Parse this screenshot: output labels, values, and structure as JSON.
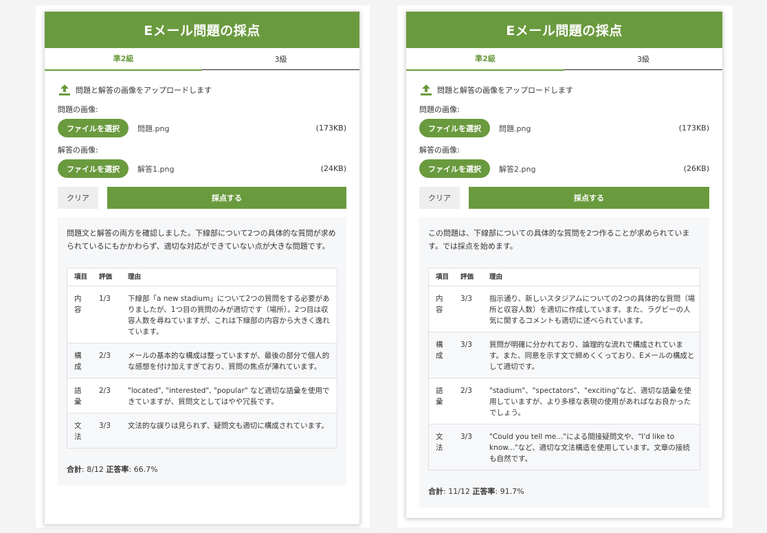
{
  "panels": [
    {
      "title": "Eメール問題の採点",
      "tabs": [
        "準2級",
        "3級"
      ],
      "upload_hint": "問題と解答の画像をアップロードします",
      "question_label": "問題の画像:",
      "answer_label": "解答の画像:",
      "choose_file_label": "ファイルを選択",
      "question_file": {
        "name": "問題.png",
        "size": "(173KB)"
      },
      "answer_file": {
        "name": "解答1.png",
        "size": "(24KB)"
      },
      "clear_label": "クリア",
      "grade_label": "採点する",
      "result_intro": "問題文と解答の両方を確認しました。下線部について2つの具体的な質問が求められているにもかかわらず、適切な対応ができていない点が大きな問題です。",
      "table_headers": [
        "項目",
        "評価",
        "理由"
      ],
      "rows": [
        {
          "item": "内容",
          "score": "1/3",
          "reason": "下線部「a new stadium」について2つの質問をする必要がありましたが、1つ目の質問のみが適切です（場所）。2つ目は収容人数を尋ねていますが、これは下線部の内容から大きく逸れています。"
        },
        {
          "item": "構成",
          "score": "2/3",
          "reason": "メールの基本的な構成は整っていますが、最後の部分で個人的な感想を付け加えすぎており、質問の焦点が薄れています。"
        },
        {
          "item": "語彙",
          "score": "2/3",
          "reason": "\"located\", \"interested\", \"popular\" など適切な語彙を使用できていますが、質問文としてはやや冗長です。"
        },
        {
          "item": "文法",
          "score": "3/3",
          "reason": "文法的な誤りは見られず、疑問文も適切に構成されています。"
        }
      ],
      "total_label": "合計",
      "total_value": ": 8/12 ",
      "rate_label": "正答率",
      "rate_value": ": 66.7%"
    },
    {
      "title": "Eメール問題の採点",
      "tabs": [
        "準2級",
        "3級"
      ],
      "upload_hint": "問題と解答の画像をアップロードします",
      "question_label": "問題の画像:",
      "answer_label": "解答の画像:",
      "choose_file_label": "ファイルを選択",
      "question_file": {
        "name": "問題.png",
        "size": "(173KB)"
      },
      "answer_file": {
        "name": "解答2.png",
        "size": "(26KB)"
      },
      "clear_label": "クリア",
      "grade_label": "採点する",
      "result_intro": "この問題は、下線部についての具体的な質問を2つ作ることが求められています。では採点を始めます。",
      "table_headers": [
        "項目",
        "評価",
        "理由"
      ],
      "rows": [
        {
          "item": "内容",
          "score": "3/3",
          "reason": "指示通り、新しいスタジアムについての2つの具体的な質問（場所と収容人数）を適切に作成しています。また、ラグビーの人気に関するコメントも適切に述べられています。"
        },
        {
          "item": "構成",
          "score": "3/3",
          "reason": "質問が明確に分かれており、論理的な流れで構成されています。また、同意を示す文で締めくくっており、Eメールの構成として適切です。"
        },
        {
          "item": "語彙",
          "score": "2/3",
          "reason": "\"stadium\"、\"spectators\"、\"exciting\"など、適切な語彙を使用していますが、より多様な表現の使用があればなお良かったでしょう。"
        },
        {
          "item": "文法",
          "score": "3/3",
          "reason": "\"Could you tell me...\"による間接疑問文や、\"I'd like to know...\"など、適切な文法構造を使用しています。文章の接続も自然です。"
        }
      ],
      "total_label": "合計",
      "total_value": ": 11/12 ",
      "rate_label": "正答率",
      "rate_value": ": 91.7%"
    }
  ],
  "colors": {
    "accent": "#6a9a3e",
    "result_bg": "#f6f7f9"
  },
  "icons": {
    "upload": "upload-icon"
  }
}
